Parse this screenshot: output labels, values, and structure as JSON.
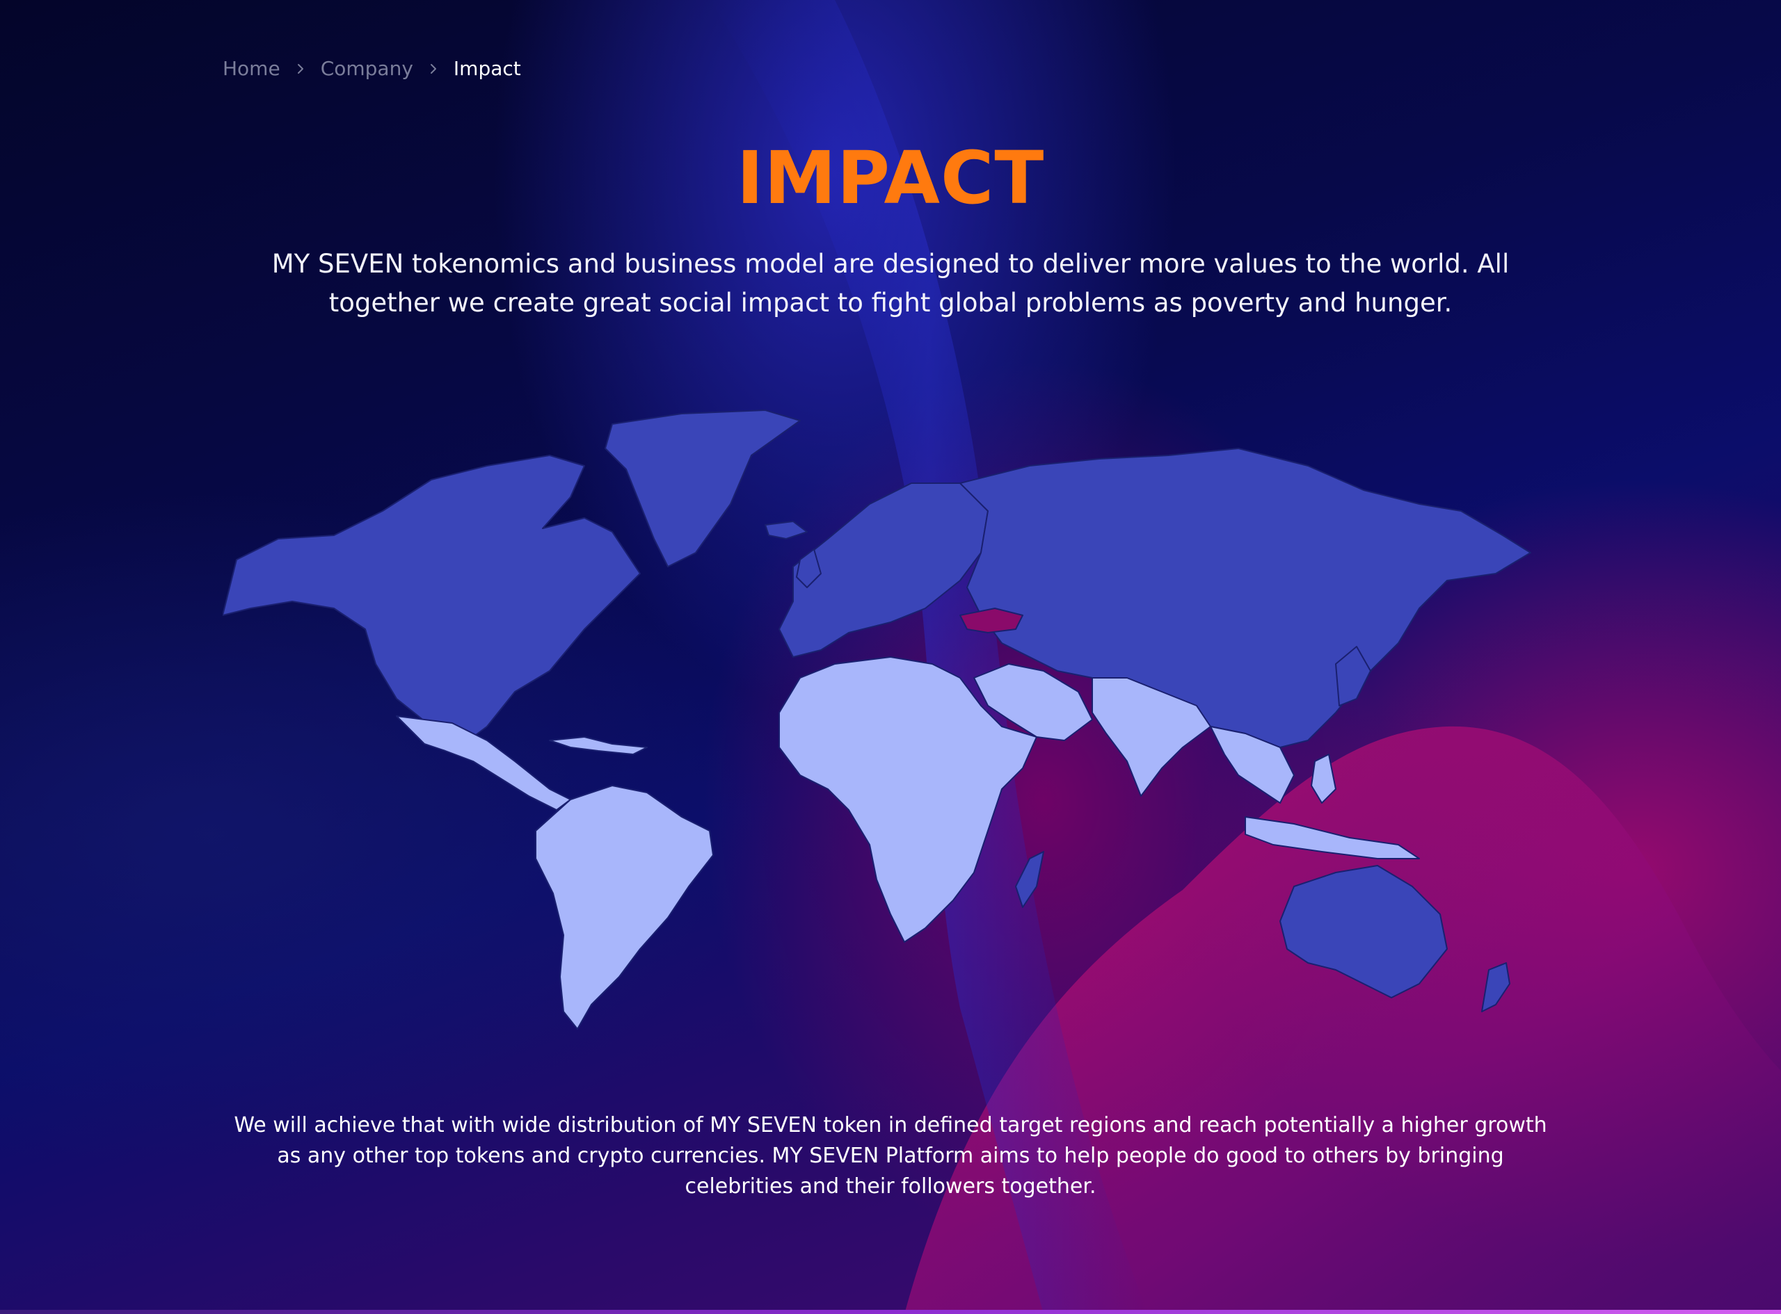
{
  "breadcrumb": {
    "items": [
      {
        "label": "Home"
      },
      {
        "label": "Company"
      },
      {
        "label": "Impact"
      }
    ]
  },
  "header": {
    "title": "IMPACT"
  },
  "intro": {
    "text": "MY SEVEN tokenomics and business model are designed to deliver more values to the world. All together we create great social impact to fight global problems as poverty and hunger."
  },
  "map": {
    "colors": {
      "target_region": "#a8b6fb",
      "other_region": "#3a45b8",
      "highlight_region": "#8a0a6a",
      "borders": "#1a2070"
    }
  },
  "outro": {
    "text": "We will achieve that with wide distribution of MY SEVEN token in defined target regions and reach potentially a higher growth as any other top tokens and crypto currencies. MY SEVEN Platform aims to help people do good to others by bringing celebrities and their followers together."
  }
}
